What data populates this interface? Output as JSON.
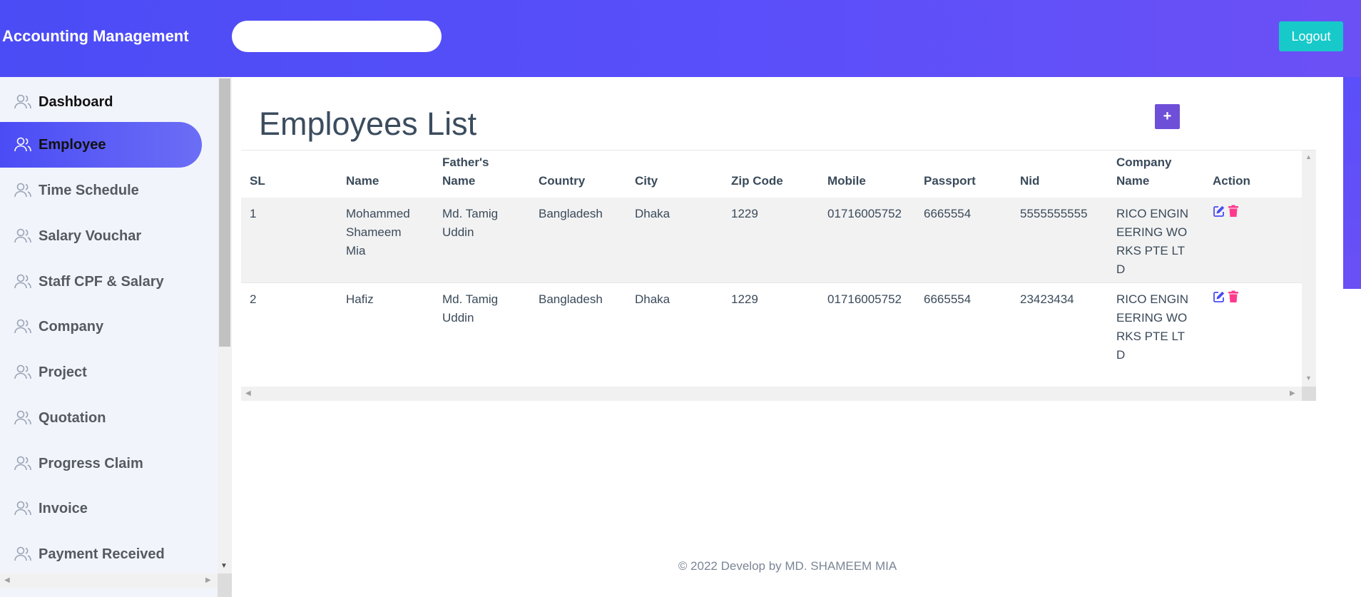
{
  "header": {
    "brand": "Accounting Management",
    "search_placeholder": "",
    "logout_label": "Logout"
  },
  "sidebar": {
    "items": [
      {
        "label": "Dashboard"
      },
      {
        "label": "Employee"
      },
      {
        "label": "Time Schedule"
      },
      {
        "label": "Salary Vouchar"
      },
      {
        "label": "Staff CPF & Salary"
      },
      {
        "label": "Company"
      },
      {
        "label": "Project"
      },
      {
        "label": "Quotation"
      },
      {
        "label": "Progress Claim"
      },
      {
        "label": "Invoice"
      },
      {
        "label": "Payment Received"
      }
    ],
    "active": "Employee"
  },
  "main": {
    "title": "Employees List",
    "add_label": "+",
    "table": {
      "columns": [
        "SL",
        "Name",
        "Father's Name",
        "Country",
        "City",
        "Zip Code",
        "Mobile",
        "Passport",
        "Nid",
        "Company Name",
        "Action"
      ],
      "rows": [
        [
          "1",
          "Mohammed Shameem Mia",
          "Md. Tamig Uddin",
          "Bangladesh",
          "Dhaka",
          "1229",
          "01716005752",
          "6665554",
          "5555555555",
          "RICO ENGINEERING WORKS PTE LTD"
        ],
        [
          "2",
          "Hafiz",
          "Md. Tamig Uddin",
          "Bangladesh",
          "Dhaka",
          "1229",
          "01716005752",
          "6665554",
          "23423434",
          "RICO ENGINEERING WORKS PTE LTD"
        ]
      ]
    }
  },
  "footer": {
    "text": "© 2022 Develop by MD. SHAMEEM MIA"
  },
  "colors": {
    "header": "#4b4cf5",
    "active_nav": "#4b4cf5",
    "logout": "#17c9c9",
    "add_button": "#6e4fd8",
    "edit_icon": "#4b4cf5",
    "delete_icon": "#ff3b8d"
  },
  "icons": {
    "nav": "users-icon",
    "edit": "edit-icon",
    "delete": "trash-icon"
  }
}
